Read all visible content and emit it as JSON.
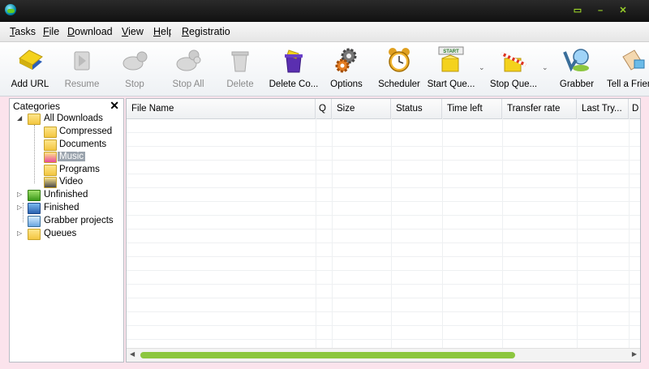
{
  "window": {
    "buttons": {
      "restore": "▭",
      "minimize": "–",
      "close": "✕"
    }
  },
  "menu": {
    "items": [
      {
        "u": "T",
        "rest": "asks"
      },
      {
        "u": "F",
        "rest": "ile"
      },
      {
        "u": "D",
        "rest": "ownload"
      },
      {
        "u": "V",
        "rest": "iew"
      },
      {
        "u": "H",
        "rest": "elp"
      },
      {
        "u": "R",
        "rest": "egistratio"
      }
    ]
  },
  "toolbar": {
    "buttons": [
      {
        "label": "Add URL",
        "icon": "add-url-icon",
        "enabled": true
      },
      {
        "label": "Resume",
        "icon": "resume-icon",
        "enabled": false
      },
      {
        "label": "Stop",
        "icon": "stop-icon",
        "enabled": false
      },
      {
        "label": "Stop All",
        "icon": "stop-all-icon",
        "enabled": false
      },
      {
        "label": "Delete",
        "icon": "delete-icon",
        "enabled": false
      },
      {
        "label": "Delete Co...",
        "icon": "delete-completed-icon",
        "enabled": true
      },
      {
        "label": "Options",
        "icon": "options-gear-icon",
        "enabled": true
      },
      {
        "label": "Scheduler",
        "icon": "alarm-clock-icon",
        "enabled": true
      },
      {
        "label": "Start Que...",
        "icon": "start-queue-icon",
        "enabled": true
      },
      {
        "label": "Stop Que...",
        "icon": "stop-queue-icon",
        "enabled": true
      },
      {
        "label": "Grabber",
        "icon": "grabber-icon",
        "enabled": true
      },
      {
        "label": "Tell a Frien",
        "icon": "tell-a-friend-icon",
        "enabled": true
      }
    ],
    "start_sign": "START",
    "dropdown_glyph": "⌄"
  },
  "sidebar": {
    "title": "Categories",
    "close": "✕",
    "tree": {
      "all_downloads": "All Downloads",
      "compressed": "Compressed",
      "documents": "Documents",
      "music": "Music",
      "programs": "Programs",
      "video": "Video",
      "unfinished": "Unfinished",
      "finished": "Finished",
      "grabber_projects": "Grabber projects",
      "queues": "Queues"
    },
    "selected": "Music"
  },
  "grid": {
    "columns": [
      "File Name",
      "Q",
      "Size",
      "Status",
      "Time left",
      "Transfer rate",
      "Last Try...",
      "D"
    ],
    "rows": []
  },
  "colors": {
    "titlebar": "#1a1a1a",
    "accent_green": "#8cc63f",
    "background_pink": "#fbe3ec"
  }
}
